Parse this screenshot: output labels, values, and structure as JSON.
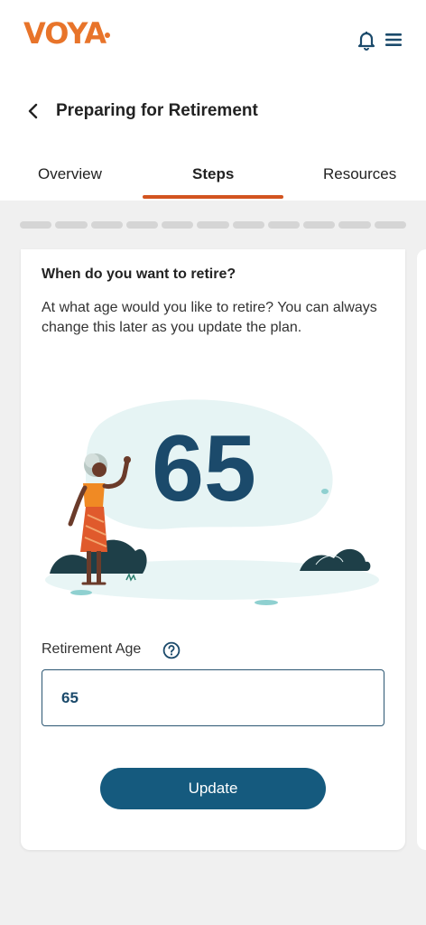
{
  "header": {
    "logo_text": "VOYA",
    "brand_color": "#e8742a",
    "icons": [
      "bell-icon",
      "hamburger-menu-icon"
    ]
  },
  "page": {
    "title": "Preparing for Retirement",
    "back_icon": "chevron-left-icon"
  },
  "tabs": [
    {
      "label": "Overview",
      "active": false
    },
    {
      "label": "Steps",
      "active": true
    },
    {
      "label": "Resources",
      "active": false
    }
  ],
  "progress": {
    "segments": 11,
    "completed": 0
  },
  "step": {
    "title": "When do you want to retire?",
    "description": "At what age would you like to retire? You can always change this later as you update the plan.",
    "illustration_value": "65"
  },
  "form": {
    "label": "Retirement Age",
    "help_icon": "question-circle-icon",
    "value": "65",
    "button_label": "Update"
  },
  "colors": {
    "accent": "#d2541f",
    "primary": "#155a7e",
    "text": "#222222"
  }
}
